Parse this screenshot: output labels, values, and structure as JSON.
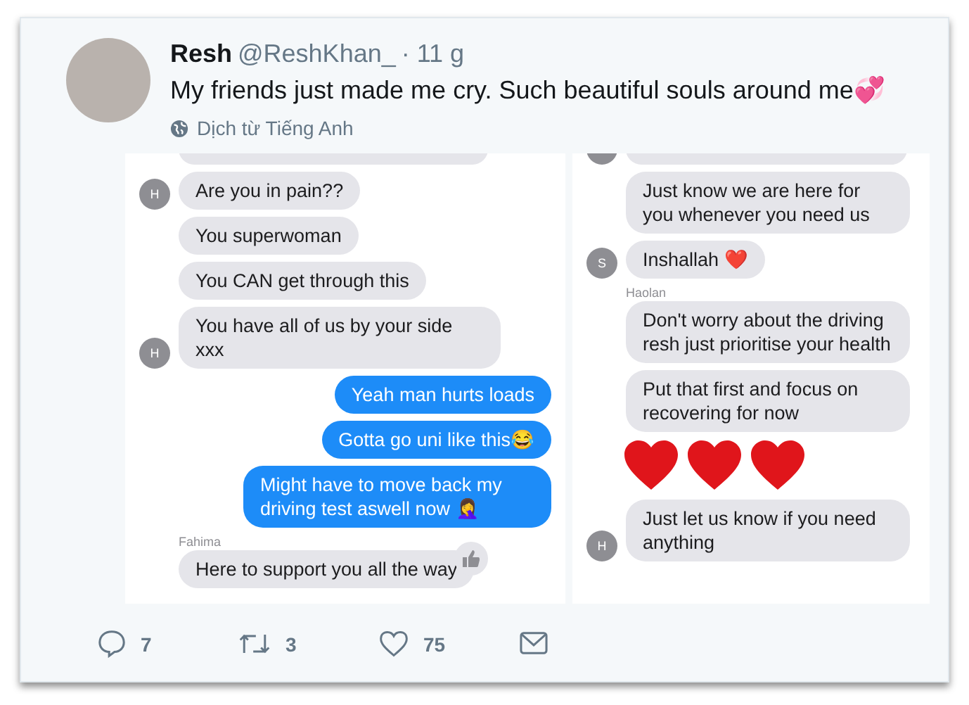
{
  "tweet": {
    "name": "Resh",
    "handle": "@ReshKhan_",
    "time": "· 11 g",
    "text": "My friends just made me cry. Such beautiful souls around me💞",
    "translate": "Dịch từ Tiếng Anh"
  },
  "panels": [
    {
      "messages": [
        {
          "kind": "stub"
        },
        {
          "kind": "in",
          "text": "Are you in pain??",
          "avatar": "H"
        },
        {
          "kind": "in",
          "text": "You superwoman"
        },
        {
          "kind": "in",
          "text": "You CAN get through this"
        },
        {
          "kind": "in",
          "text": "You have all of us by your side xxx",
          "avatar": "H"
        },
        {
          "kind": "out",
          "text": "Yeah man hurts loads"
        },
        {
          "kind": "out",
          "text": "Gotta go uni like this😂"
        },
        {
          "kind": "out",
          "text": "Might have to move back my driving test aswell now 🤦‍♀️"
        },
        {
          "kind": "sender",
          "text": "Fahima"
        },
        {
          "kind": "in",
          "text": "Here to support you all the way",
          "reaction": true
        }
      ]
    },
    {
      "messages": [
        {
          "kind": "stub_avatar"
        },
        {
          "kind": "in",
          "text": "Just know we are here for you whenever you need us"
        },
        {
          "kind": "in",
          "text": "Inshallah ❤️",
          "avatar": "S"
        },
        {
          "kind": "sender",
          "text": "Haolan"
        },
        {
          "kind": "in",
          "text": "Don't worry about the driving resh just prioritise your health"
        },
        {
          "kind": "in",
          "text": "Put that first and focus on recovering for now"
        },
        {
          "kind": "hearts"
        },
        {
          "kind": "in",
          "text": "Just let us know if you need anything",
          "avatar": "H"
        }
      ]
    }
  ],
  "actions": [
    {
      "kind": "reply",
      "count": "7"
    },
    {
      "kind": "retweet",
      "count": "3"
    },
    {
      "kind": "like",
      "count": "75"
    },
    {
      "kind": "message"
    }
  ]
}
